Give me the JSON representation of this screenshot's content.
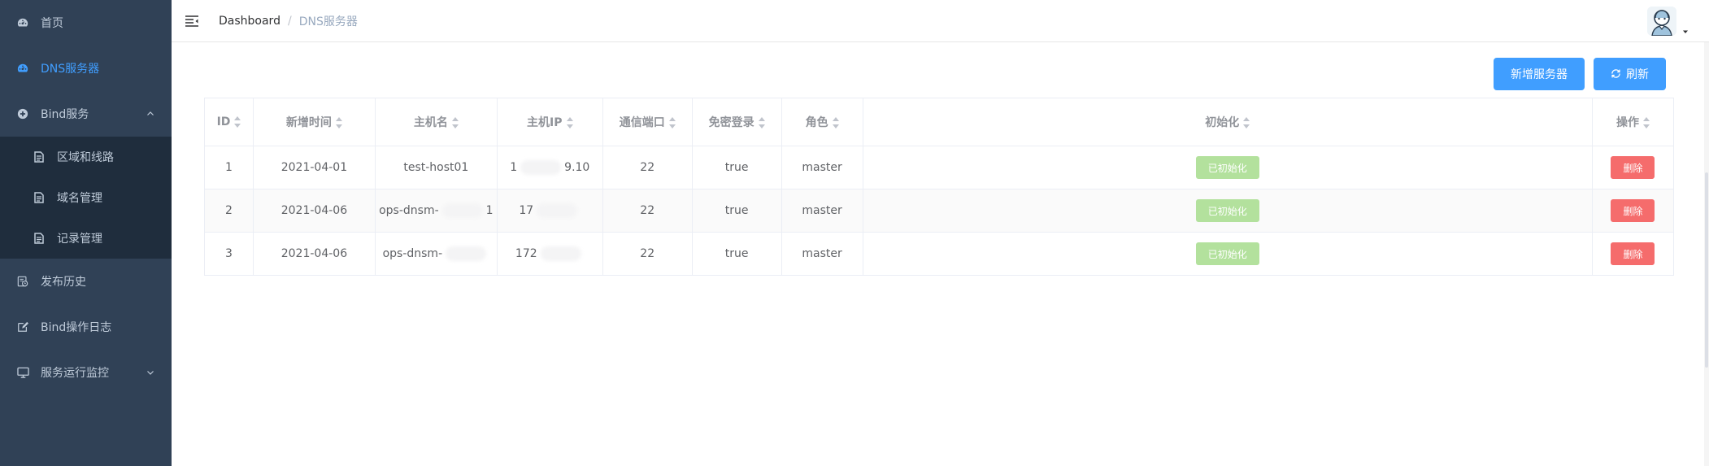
{
  "sidebar": {
    "items": [
      {
        "label": "首页",
        "icon": "dashboard-icon",
        "active": false
      },
      {
        "label": "DNS服务器",
        "icon": "dashboard-icon",
        "active": true
      },
      {
        "label": "Bind服务",
        "icon": "plus-circle-icon",
        "expanded": true,
        "children": [
          {
            "label": "区域和线路",
            "icon": "document-icon"
          },
          {
            "label": "域名管理",
            "icon": "document-icon"
          },
          {
            "label": "记录管理",
            "icon": "document-icon"
          }
        ]
      },
      {
        "label": "发布历史",
        "icon": "history-icon"
      },
      {
        "label": "Bind操作日志",
        "icon": "edit-icon"
      },
      {
        "label": "服务运行监控",
        "icon": "monitor-icon",
        "expandable": true
      }
    ],
    "colors": {
      "bg": "#304156",
      "sub_bg": "#1f2d3d",
      "text": "#bfcbd9",
      "active": "#409eff"
    }
  },
  "header": {
    "breadcrumb": {
      "home": "Dashboard",
      "separator": "/",
      "current": "DNS服务器"
    }
  },
  "toolbar": {
    "add_label": "新增服务器",
    "refresh_label": "刷新"
  },
  "table": {
    "columns": [
      "ID",
      "新增时间",
      "主机名",
      "主机IP",
      "通信端口",
      "免密登录",
      "角色",
      "初始化",
      "操作"
    ],
    "rows": [
      {
        "id": "1",
        "created": "2021-04-01",
        "hostname": "test-host01",
        "ip_a": "1",
        "ip_b": "9.10",
        "port": "22",
        "nopass": "true",
        "role": "master",
        "init": "已初始化",
        "action": "删除"
      },
      {
        "id": "2",
        "created": "2021-04-06",
        "hostname_a": "ops-dnsm-",
        "hostname_b": "1",
        "ip_a": "17",
        "ip_b": "",
        "port": "22",
        "nopass": "true",
        "role": "master",
        "init": "已初始化",
        "action": "删除"
      },
      {
        "id": "3",
        "created": "2021-04-06",
        "hostname_a": "ops-dnsm-",
        "hostname_b": "",
        "ip_a": "172",
        "ip_b": "",
        "port": "22",
        "nopass": "true",
        "role": "master",
        "init": "已初始化",
        "action": "删除"
      }
    ]
  },
  "colors": {
    "primary": "#409eff",
    "success_light": "#b3e19d",
    "danger": "#f56c6c"
  }
}
